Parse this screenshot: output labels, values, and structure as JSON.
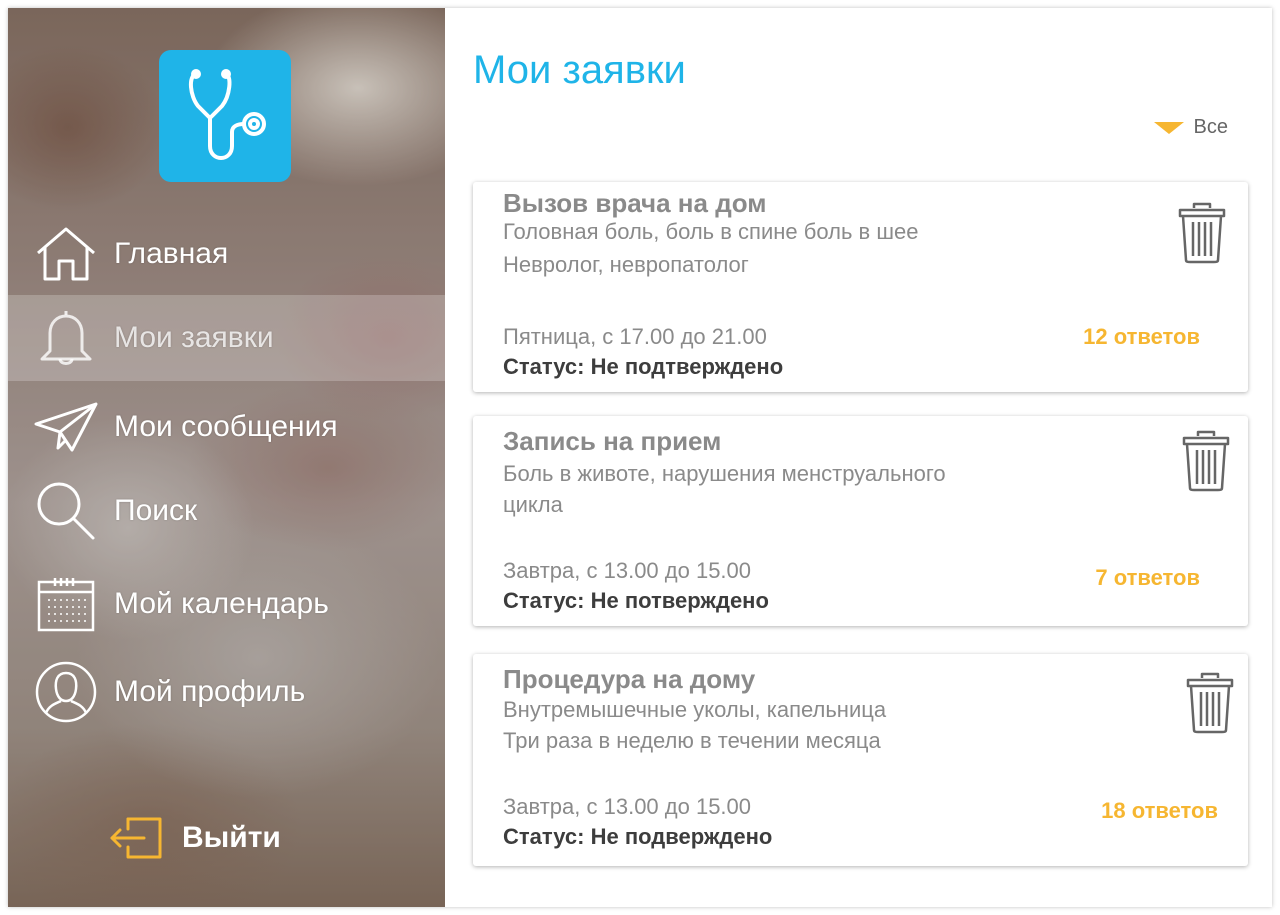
{
  "sidebar": {
    "logo_icon": "stethoscope-icon",
    "items": [
      {
        "label": "Главная",
        "icon": "home-icon",
        "active": false
      },
      {
        "label": "Мои заявки",
        "icon": "bell-icon",
        "active": true
      },
      {
        "label": "Мои сообщения",
        "icon": "paper-plane-icon",
        "active": false
      },
      {
        "label": "Поиск",
        "icon": "search-icon",
        "active": false
      },
      {
        "label": "Мой календарь",
        "icon": "calendar-icon",
        "active": false
      },
      {
        "label": "Мой профиль",
        "icon": "profile-icon",
        "active": false
      }
    ],
    "logout": {
      "label": "Выйти",
      "icon": "logout-icon"
    }
  },
  "main": {
    "title": "Мои заявки",
    "filter": {
      "label": "Все",
      "icon": "triangle-down-icon"
    },
    "requests": [
      {
        "title": "Вызов врача на дом",
        "desc": [
          "Головная боль, боль в спине боль в шее",
          "Невролог, невропатолог"
        ],
        "time": "Пятница, с 17.00 до 21.00",
        "status": "Статус: Не подтверждено",
        "answers": "12 ответов"
      },
      {
        "title": "Запись на прием",
        "desc": [
          "Боль в животе, нарушения менструального",
          "цикла"
        ],
        "time": "Завтра, с 13.00 до 15.00",
        "status": "Статус: Не потверждено",
        "answers": "7 ответов"
      },
      {
        "title": "Процедура на дому",
        "desc": [
          "Внутремышечные уколы, капельница",
          "Три раза в неделю в течении месяца"
        ],
        "time": "Завтра, с 13.00 до 15.00",
        "status": "Статус: Не подверждено",
        "answers": "18 ответов"
      }
    ]
  },
  "colors": {
    "accent_blue": "#1fb4e8",
    "accent_orange": "#f6b631",
    "text_gray": "#8a8a8a",
    "text_dark": "#3d3d3d"
  }
}
